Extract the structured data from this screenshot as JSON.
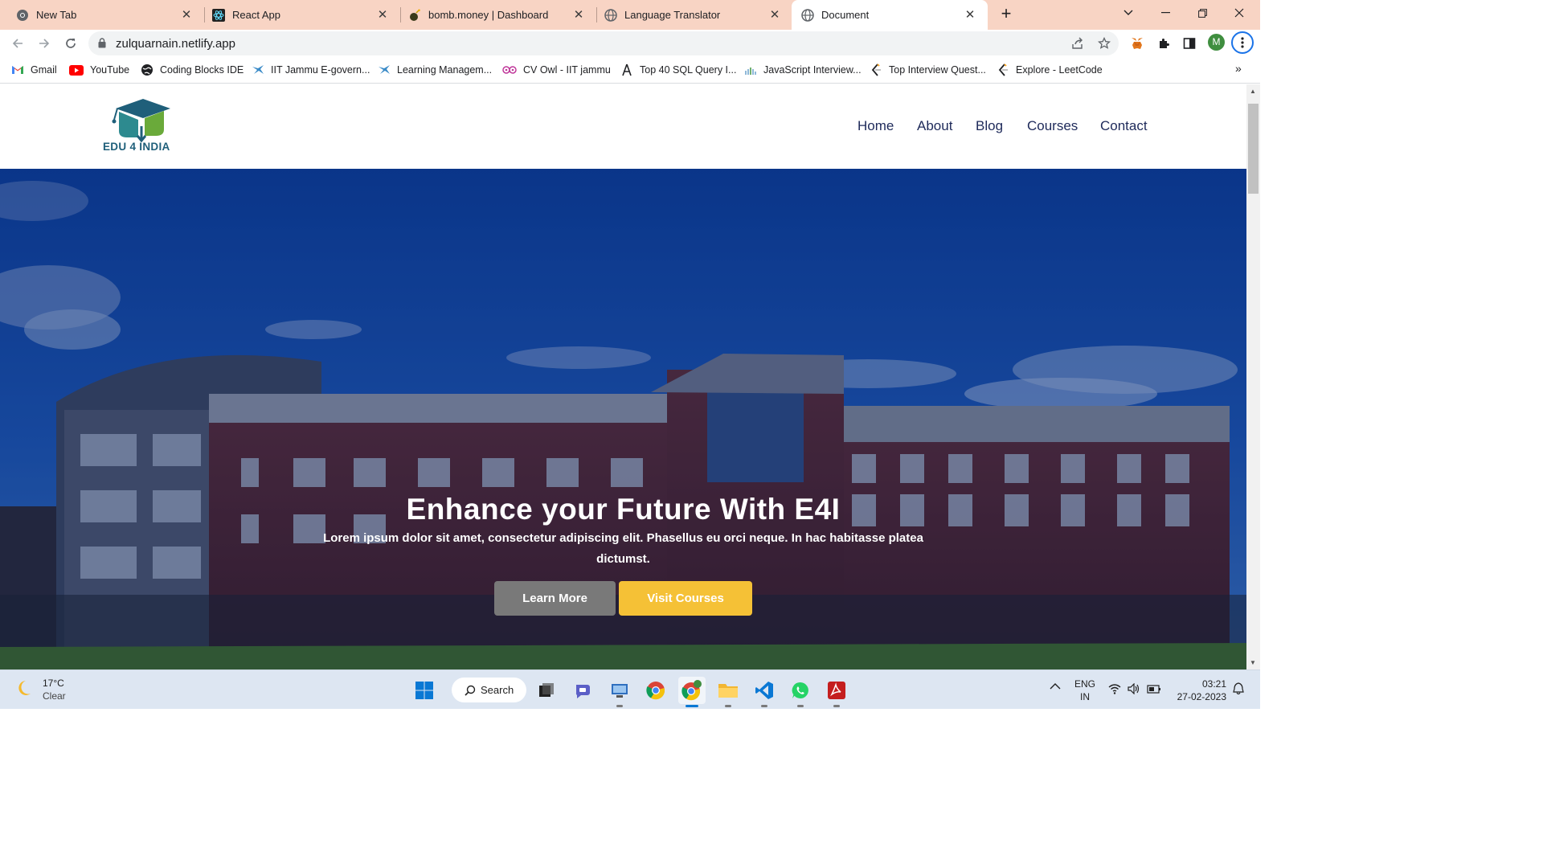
{
  "browser": {
    "tabs": [
      {
        "title": "New Tab",
        "icon": "chrome-icon"
      },
      {
        "title": "React App",
        "icon": "react-icon"
      },
      {
        "title": "bomb.money | Dashboard",
        "icon": "bomb-icon"
      },
      {
        "title": "Language Translator",
        "icon": "globe-icon"
      },
      {
        "title": "Document",
        "icon": "globe-icon",
        "active": true
      }
    ],
    "url": "zulquarnain.netlify.app",
    "profile_initial": "M",
    "bookmarks": [
      {
        "label": "Gmail"
      },
      {
        "label": "YouTube"
      },
      {
        "label": "Coding Blocks IDE"
      },
      {
        "label": "IIT Jammu E-govern..."
      },
      {
        "label": "Learning Managem..."
      },
      {
        "label": "CV Owl - IIT jammu"
      },
      {
        "label": "Top 40 SQL Query I..."
      },
      {
        "label": "JavaScript Interview..."
      },
      {
        "label": "Top Interview Quest..."
      },
      {
        "label": "Explore - LeetCode"
      }
    ]
  },
  "site": {
    "logo_text": "EDU 4 INDIA",
    "nav": [
      "Home",
      "About",
      "Blog",
      "Courses",
      "Contact"
    ],
    "hero": {
      "title": "Enhance your Future With E4I",
      "subtitle": "Lorem ipsum dolor sit amet, consectetur adipiscing elit. Phasellus eu orci neque. In hac habitasse platea dictumst.",
      "learn_more": "Learn More",
      "visit_courses": "Visit Courses"
    }
  },
  "taskbar": {
    "weather_temp": "17°C",
    "weather_cond": "Clear",
    "search_label": "Search",
    "lang_top": "ENG",
    "lang_bottom": "IN",
    "time": "03:21",
    "date": "27-02-2023"
  },
  "colors": {
    "tabstrip": "#f8d4c4",
    "nav_text": "#1e2a5a",
    "learn_btn": "#797979",
    "courses_btn": "#f5c136"
  }
}
